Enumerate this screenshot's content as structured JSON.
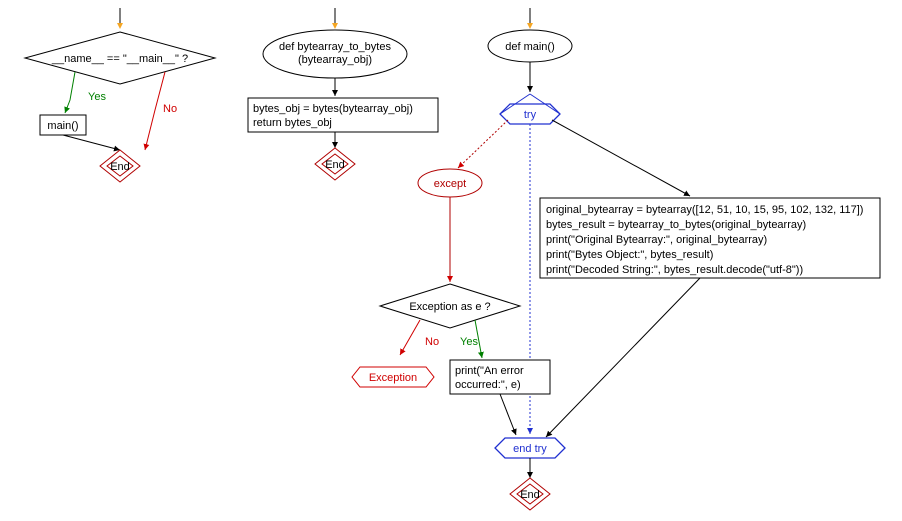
{
  "flowchart1": {
    "decision": "__name__ == \"__main__\" ?",
    "yes": "Yes",
    "no": "No",
    "main": "main()",
    "end": "End"
  },
  "flowchart2": {
    "def": "def bytearray_to_bytes\n(bytearray_obj)",
    "def_line1": "def bytearray_to_bytes",
    "def_line2": "(bytearray_obj)",
    "body_line1": "bytes_obj = bytes(bytearray_obj)",
    "body_line2": "return bytes_obj",
    "end": "End"
  },
  "flowchart3": {
    "def": "def main()",
    "try": "try",
    "except": "except",
    "exception_check": "Exception as e ?",
    "yes": "Yes",
    "no": "No",
    "exception_box": "Exception",
    "print_err_line1": "print(\"An error",
    "print_err_line2": "occurred:\", e)",
    "try_body_line1": "original_bytearray = bytearray([12, 51, 10, 15, 95, 102, 132, 117])",
    "try_body_line2": "bytes_result = bytearray_to_bytes(original_bytearray)",
    "try_body_line3": "print(\"Original Bytearray:\", original_bytearray)",
    "try_body_line4": "print(\"Bytes Object:\", bytes_result)",
    "try_body_line5": "print(\"Decoded String:\", bytes_result.decode(\"utf-8\"))",
    "end_try": "end try",
    "end": "End"
  },
  "colors": {
    "yes": "#008000",
    "no": "#d00000",
    "try": "#2030d0",
    "except": "#b00000",
    "arrow_fill": "#f5a623"
  }
}
